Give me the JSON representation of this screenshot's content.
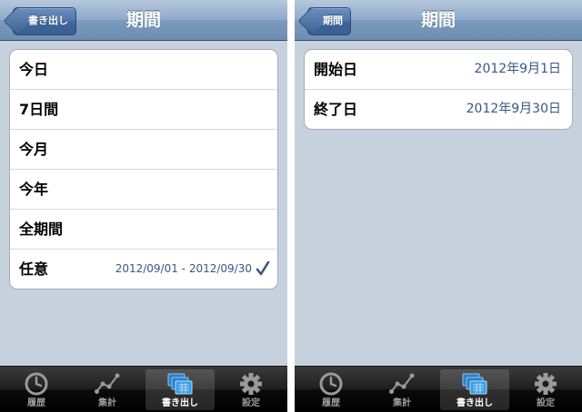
{
  "left": {
    "navbar": {
      "title": "期間",
      "back_label": "書き出し"
    },
    "rows": [
      {
        "label": "今日"
      },
      {
        "label": "7日間"
      },
      {
        "label": "今月"
      },
      {
        "label": "今年"
      },
      {
        "label": "全期間"
      },
      {
        "label": "任意",
        "detail": "2012/09/01 - 2012/09/30",
        "checked": true
      }
    ]
  },
  "right": {
    "navbar": {
      "title": "期間",
      "back_label": "期間"
    },
    "rows": [
      {
        "label": "開始日",
        "value": "2012年9月1日"
      },
      {
        "label": "終了日",
        "value": "2012年9月30日"
      }
    ]
  },
  "tabbar": {
    "tabs": [
      {
        "label": "履歴",
        "icon": "clock-icon"
      },
      {
        "label": "集計",
        "icon": "line-chart-icon"
      },
      {
        "label": "書き出し",
        "icon": "export-icon",
        "selected": true
      },
      {
        "label": "設定",
        "icon": "gear-icon"
      }
    ]
  },
  "colors": {
    "background": "#c6d1dd",
    "navbar": "#7b9abd",
    "detail_text": "#3b5684",
    "tabbar": "#000000"
  }
}
